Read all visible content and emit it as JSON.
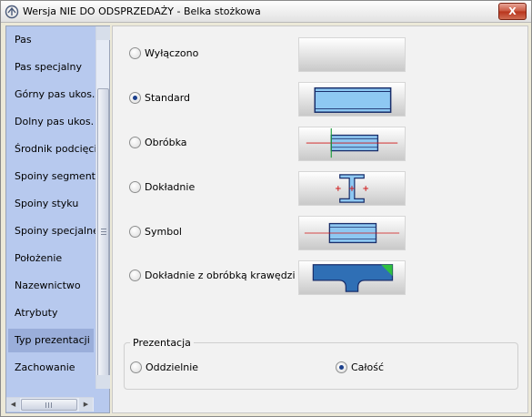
{
  "window": {
    "title": "Wersja NIE DO ODSPRZEDAŻY - Belka stożkowa",
    "close_label": "X"
  },
  "sidebar": {
    "items": [
      {
        "label": "Pas",
        "selected": false
      },
      {
        "label": "Pas specjalny",
        "selected": false
      },
      {
        "label": "Górny pas ukos.",
        "selected": false
      },
      {
        "label": "Dolny pas ukos.",
        "selected": false
      },
      {
        "label": "Środnik podcięcia",
        "selected": false
      },
      {
        "label": "Spoiny segmentu",
        "selected": false
      },
      {
        "label": "Spoiny styku",
        "selected": false
      },
      {
        "label": "Spoiny specjalne",
        "selected": false
      },
      {
        "label": "Położenie",
        "selected": false
      },
      {
        "label": "Nazewnictwo",
        "selected": false
      },
      {
        "label": "Atrybuty",
        "selected": false
      },
      {
        "label": "Typ prezentacji",
        "selected": true
      },
      {
        "label": "Zachowanie",
        "selected": false
      }
    ]
  },
  "presentation_options": [
    {
      "label": "Wyłączono",
      "checked": false,
      "preview": "blank-preview"
    },
    {
      "label": "Standard",
      "checked": true,
      "preview": "standard-beam-preview"
    },
    {
      "label": "Obróbka",
      "checked": false,
      "preview": "machining-preview"
    },
    {
      "label": "Dokładnie",
      "checked": false,
      "preview": "exact-ibeam-preview"
    },
    {
      "label": "Symbol",
      "checked": false,
      "preview": "symbol-preview"
    },
    {
      "label": "Dokładnie z obróbką krawędzi",
      "checked": false,
      "preview": "exact-edge-preview"
    }
  ],
  "presentation_group": {
    "legend": "Prezentacja",
    "options": [
      {
        "label": "Oddzielnie",
        "checked": false
      },
      {
        "label": "Całość",
        "checked": true
      }
    ]
  },
  "colors": {
    "beam_fill": "#8ec8f2",
    "beam_stroke": "#1a2f6b",
    "axis_red": "#d01515",
    "axis_green": "#1a9a3a",
    "sidebar_bg": "#b7c9ee",
    "selected_bg": "#9aaeda"
  }
}
